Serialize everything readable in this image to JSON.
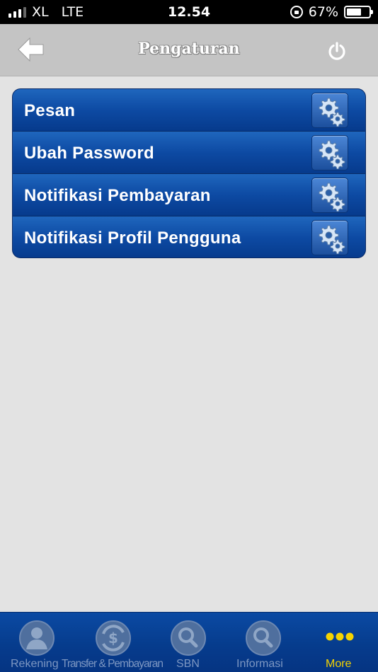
{
  "status_bar": {
    "carrier": "XL",
    "network": "LTE",
    "time": "12.54",
    "battery": "67%",
    "battery_level": 0.67
  },
  "header": {
    "title": "Pengaturan",
    "back_icon": "arrow-left-icon",
    "power_icon": "power-icon"
  },
  "menu": {
    "items": [
      {
        "label": "Pesan",
        "icon": "gear-icon"
      },
      {
        "label": "Ubah Password",
        "icon": "gear-icon"
      },
      {
        "label": "Notifikasi Pembayaran",
        "icon": "gear-icon"
      },
      {
        "label": "Notifikasi Profil Pengguna",
        "icon": "gear-icon"
      }
    ]
  },
  "tabs": {
    "rekening": "Rekening",
    "transfer": "Transfer & Pembayaran",
    "sbn": "SBN",
    "informasi": "Informasi",
    "more": "More",
    "active": "more"
  },
  "colors": {
    "accent_blue": "#0d4aa3",
    "active_tab": "#f5d300",
    "header_gray": "#c4c4c4",
    "background": "#e3e3e3"
  }
}
